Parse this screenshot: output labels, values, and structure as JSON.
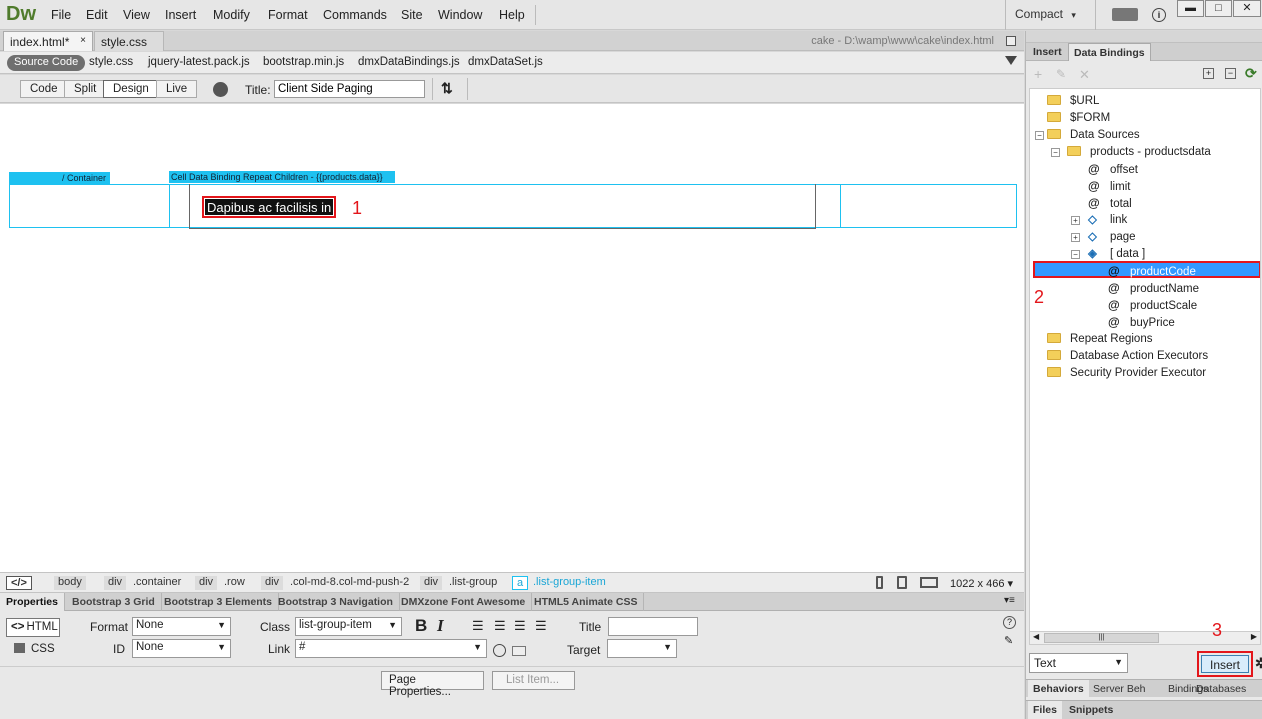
{
  "app": {
    "logo": "Dw"
  },
  "menu": [
    "File",
    "Edit",
    "View",
    "Insert",
    "Modify",
    "Format",
    "Commands",
    "Site",
    "Window",
    "Help"
  ],
  "workspace": {
    "label": "Compact",
    "caret": "▾"
  },
  "window_controls": {
    "minimize": "▬",
    "maximize": "□",
    "close": "✕"
  },
  "doc_tabs": [
    {
      "label": "index.html*"
    },
    {
      "label": "style.css"
    }
  ],
  "file_path": "cake - D:\\wamp\\www\\cake\\index.html",
  "related_files": {
    "source": "Source Code",
    "files": [
      "style.css",
      "jquery-latest.pack.js",
      "bootstrap.min.js",
      "dmxDataBindings.js",
      "dmxDataSet.js"
    ]
  },
  "view_buttons": [
    "Code",
    "Split",
    "Design",
    "Live"
  ],
  "title_label": "Title:",
  "title_value": "Client Side Paging",
  "design": {
    "container_label": "/ Container",
    "cell_label": "Cell  Data Binding Repeat Children - {{products.data}}",
    "sample_text": "Dapibus ac facilisis in"
  },
  "annotations": [
    "1",
    "2",
    "3"
  ],
  "tag_selector": {
    "root": "</>",
    "crumbs": [
      "body",
      "div",
      ".container",
      "div",
      ".row",
      "div",
      ".col-md-8.col-md-push-2",
      "div",
      ".list-group",
      "a",
      ".list-group-item"
    ],
    "size": "1022 x 466 ▾"
  },
  "properties": {
    "tabs": [
      "Properties",
      "Bootstrap 3 Grid",
      "Bootstrap 3 Elements",
      "Bootstrap 3 Navigation",
      "DMXzone Font Awesome",
      "HTML5 Animate CSS"
    ],
    "html_btn": "HTML",
    "css_btn": "CSS",
    "format_label": "Format",
    "format_value": "None",
    "class_label": "Class",
    "class_value": "list-group-item",
    "id_label": "ID",
    "id_value": "None",
    "link_label": "Link",
    "link_value": "#",
    "title_label": "Title",
    "target_label": "Target",
    "bold": "B",
    "italic": "I",
    "page_properties": "Page Properties...",
    "list_item": "List Item..."
  },
  "right_panel": {
    "tabs": [
      "Insert",
      "Data Bindings"
    ],
    "tree": {
      "url": "$URL",
      "form": "$FORM",
      "data_sources": "Data Sources",
      "products": "products - productsdata",
      "offset": "offset",
      "limit": "limit",
      "total": "total",
      "link": "link",
      "page": "page",
      "data": "[ data ]",
      "productCode": "productCode",
      "productName": "productName",
      "productScale": "productScale",
      "buyPrice": "buyPrice",
      "repeat": "Repeat Regions",
      "dbae": "Database Action Executors",
      "spe": "Security Provider Executor"
    },
    "insert_type": "Text",
    "insert_button": "Insert",
    "bottom_tabs": [
      "Behaviors",
      "Server Beh",
      "Bindings",
      "Databases"
    ],
    "bottom_tabs2": [
      "Files",
      "Snippets"
    ]
  }
}
